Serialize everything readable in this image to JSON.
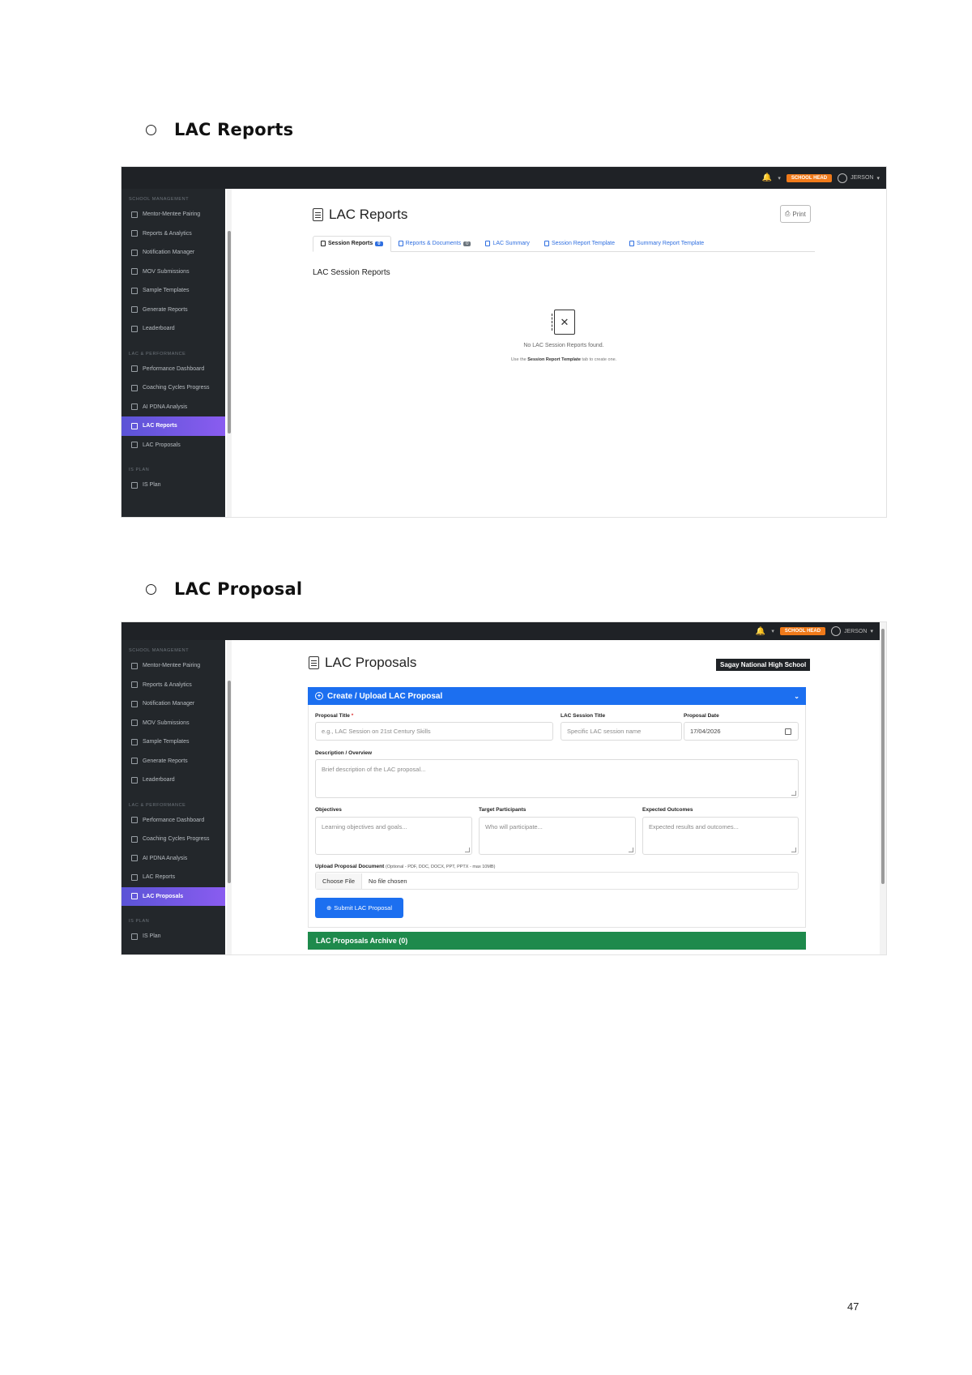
{
  "doc": {
    "section1_heading": "LAC Reports",
    "section2_heading": "LAC Proposal",
    "page_number": "47"
  },
  "topbar": {
    "role": "SCHOOL HEAD",
    "user": "JERSON"
  },
  "sidebar": {
    "groups": [
      {
        "label": "SCHOOL MANAGEMENT",
        "items": [
          "Mentor-Mentee Pairing",
          "Reports & Analytics",
          "Notification Manager",
          "MOV Submissions",
          "Sample Templates",
          "Generate Reports",
          "Leaderboard"
        ]
      },
      {
        "label": "LAC & PERFORMANCE",
        "items": [
          "Performance Dashboard",
          "Coaching Cycles Progress",
          "AI PDNA Analysis",
          "LAC Reports",
          "LAC Proposals"
        ]
      },
      {
        "label": "IS PLAN",
        "items": [
          "IS Plan"
        ]
      }
    ]
  },
  "reports_screen": {
    "title": "LAC Reports",
    "print_label": "Print",
    "tabs": [
      {
        "label": "Session Reports",
        "count": "0"
      },
      {
        "label": "Reports & Documents",
        "count": "0"
      },
      {
        "label": "LAC Summary"
      },
      {
        "label": "Session Report Template"
      },
      {
        "label": "Summary Report Template"
      }
    ],
    "sub_heading": "LAC Session Reports",
    "empty_message": "No LAC Session Reports found.",
    "hint_pre": "Use the",
    "hint_bold": "Session Report Template",
    "hint_post": "tab to create one."
  },
  "proposal_screen": {
    "title": "LAC Proposals",
    "school": "Sagay National High School",
    "card_title": "Create / Upload LAC Proposal",
    "fields": {
      "proposal_title_label": "Proposal Title",
      "proposal_title_placeholder": "e.g., LAC Session on 21st Century Skills",
      "session_title_label": "LAC Session Title",
      "session_title_placeholder": "Specific LAC session name",
      "date_label": "Proposal Date",
      "date_value": "17/04/2026",
      "description_label": "Description / Overview",
      "description_placeholder": "Brief description of the LAC proposal...",
      "objectives_label": "Objectives",
      "objectives_placeholder": "Learning objectives and goals...",
      "participants_label": "Target Participants",
      "participants_placeholder": "Who will participate...",
      "outcomes_label": "Expected Outcomes",
      "outcomes_placeholder": "Expected results and outcomes...",
      "upload_label": "Upload Proposal Document",
      "upload_hint": "(Optional - PDF, DOC, DOCX, PPT, PPTX - max 10MB)",
      "choose_file": "Choose File",
      "no_file": "No file chosen"
    },
    "submit_label": "Submit LAC Proposal",
    "archive_title": "LAC Proposals Archive (0)"
  },
  "colors": {
    "primary": "#1c6ff0",
    "active_nav_start": "#5b54d6",
    "active_nav_end": "#8a5cf0",
    "role_badge": "#f07a1a",
    "archive": "#1e8a4c",
    "topbar": "#1f2226"
  }
}
